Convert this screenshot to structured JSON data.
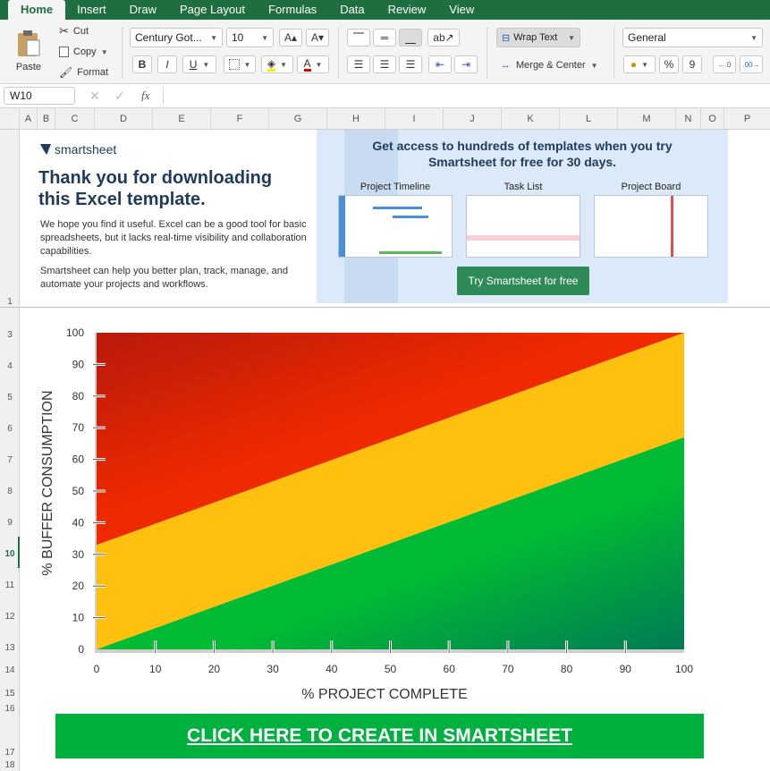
{
  "ribbon": {
    "tabs": [
      "Home",
      "Insert",
      "Draw",
      "Page Layout",
      "Formulas",
      "Data",
      "Review",
      "View"
    ],
    "clipboard": {
      "paste": "Paste",
      "cut": "Cut",
      "copy": "Copy",
      "format": "Format"
    },
    "font": {
      "name": "Century Got...",
      "size": "10",
      "bold": "B",
      "italic": "I",
      "underline": "U"
    },
    "alignment": {
      "wrap_text": "Wrap Text",
      "merge_center": "Merge & Center"
    },
    "number": {
      "format": "General",
      "percent": "%",
      "comma": "9"
    }
  },
  "formula_bar": {
    "cell": "W10",
    "fx": "fx",
    "value": ""
  },
  "columns": [
    "A",
    "B",
    "C",
    "D",
    "E",
    "F",
    "G",
    "H",
    "I",
    "J",
    "K",
    "L",
    "M",
    "N",
    "O",
    "P"
  ],
  "rows": [
    "1",
    "3",
    "4",
    "5",
    "6",
    "7",
    "8",
    "9",
    "10",
    "11",
    "12",
    "13",
    "14",
    "15",
    "16",
    "17",
    "18"
  ],
  "banner": {
    "brand": "smartsheet",
    "title": "Thank you for downloading this Excel template.",
    "para1": "We hope you find it useful. Excel can be a good tool for basic spreadsheets, but it lacks real-time visibility and collaboration capabilities.",
    "para2": "Smartsheet can help you better plan, track, manage, and automate your projects and workflows.",
    "right_title": "Get access to hundreds of templates when you try Smartsheet for free for 30 days.",
    "thumbs": [
      "Project Timeline",
      "Task List",
      "Project Board"
    ],
    "button": "Try Smartsheet for free"
  },
  "chart_data": {
    "type": "area",
    "title": "",
    "xlabel": "% PROJECT COMPLETE",
    "ylabel": "% BUFFER CONSUMPTION",
    "xlim": [
      0,
      100
    ],
    "ylim": [
      0,
      100
    ],
    "x_ticks": [
      0,
      10,
      20,
      30,
      40,
      50,
      60,
      70,
      80,
      90,
      100
    ],
    "y_ticks": [
      0,
      10,
      20,
      30,
      40,
      50,
      60,
      70,
      80,
      90,
      100
    ],
    "zones": [
      {
        "name": "green",
        "color": "#00bb33",
        "boundary_from": [
          [
            0,
            0
          ],
          [
            100,
            0
          ]
        ],
        "boundary_to": [
          [
            0,
            0
          ],
          [
            100,
            67
          ]
        ]
      },
      {
        "name": "yellow",
        "color": "#ffc010",
        "boundary_from": [
          [
            0,
            0
          ],
          [
            100,
            67
          ]
        ],
        "boundary_to": [
          [
            0,
            33
          ],
          [
            100,
            100
          ]
        ]
      },
      {
        "name": "red",
        "color": "#ee2200",
        "boundary_from": [
          [
            0,
            33
          ],
          [
            100,
            100
          ]
        ],
        "boundary_to": [
          [
            0,
            100
          ],
          [
            100,
            100
          ]
        ]
      }
    ]
  },
  "cta": {
    "label": "CLICK HERE TO CREATE IN SMARTSHEET"
  }
}
